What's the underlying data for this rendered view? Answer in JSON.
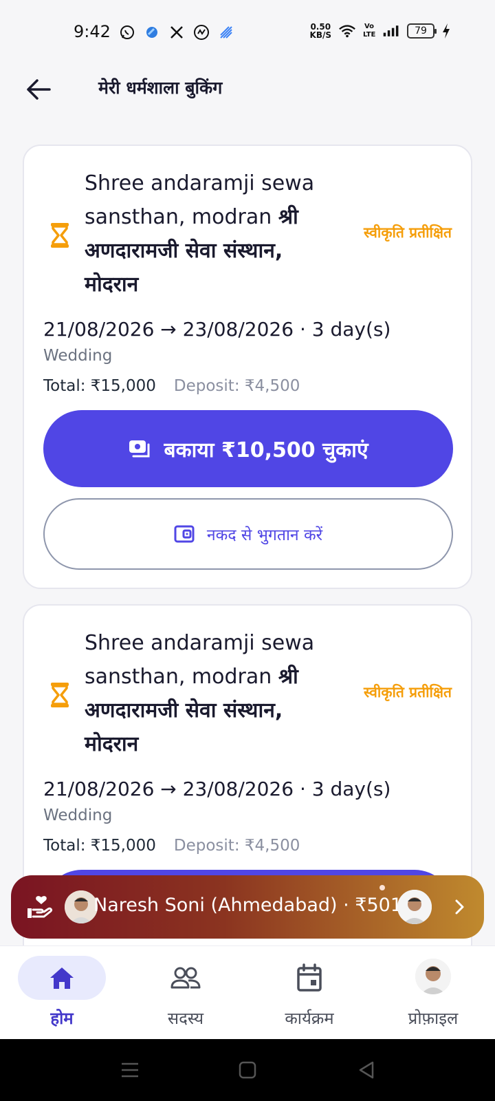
{
  "status_bar": {
    "time": "9:42",
    "net_speed_top": "0.50",
    "net_speed_bottom": "KB/S",
    "volte": "Vo LTE",
    "battery": "79",
    "left_icons": [
      "whatsapp-icon",
      "app-icon",
      "x-icon",
      "threads-icon",
      "signal-app-icon"
    ]
  },
  "app_bar": {
    "title": "मेरी धर्मशाला बुकिंग"
  },
  "bookings": [
    {
      "title_en": "Shree andaramji sewa sansthan, modran",
      "title_hi": "श्री अणदारामजी सेवा संस्थान, मोदरान",
      "status": "स्वीकृति प्रतीक्षित",
      "date_from": "21/08/2026",
      "arrow": "→",
      "date_to": "23/08/2026",
      "duration": "· 3 day(s)",
      "purpose": "Wedding",
      "total": "Total: ₹15,000",
      "deposit": "Deposit: ₹4,500",
      "pay_label": "बकाया ₹10,500 चुकाएं",
      "cash_label": "नकद से भुगतान करें"
    },
    {
      "title_en": "Shree andaramji sewa sansthan, modran",
      "title_hi": "श्री अणदारामजी सेवा संस्थान, मोदरान",
      "status": "स्वीकृति प्रतीक्षित",
      "date_from": "21/08/2026",
      "arrow": "→",
      "date_to": "23/08/2026",
      "duration": "· 3 day(s)",
      "purpose": "Wedding",
      "total": "Total: ₹15,000",
      "deposit": "Deposit: ₹4,500"
    }
  ],
  "donor_banner": {
    "text": "Naresh Soni (Ahmedabad) · ₹501"
  },
  "bottom_nav": [
    {
      "label": "होम",
      "icon": "home-icon",
      "active": true
    },
    {
      "label": "सदस्य",
      "icon": "members-icon",
      "active": false
    },
    {
      "label": "कार्यक्रम",
      "icon": "calendar-icon",
      "active": false
    },
    {
      "label": "प्रोफ़ाइल",
      "icon": "profile-avatar",
      "active": false
    }
  ],
  "colors": {
    "primary": "#5046e5",
    "pending": "#f59e0b",
    "banner_start": "#7a1422",
    "banner_end": "#c08a2e"
  }
}
